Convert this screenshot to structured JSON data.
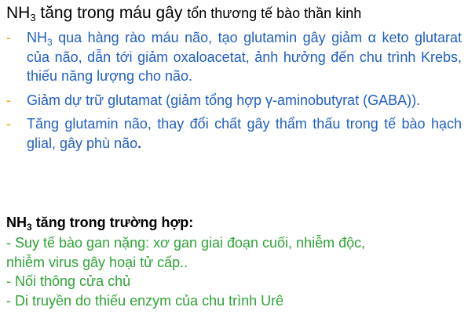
{
  "title": {
    "nh": "NH",
    "sub": "3",
    "main": " tăng trong máu gây ",
    "rest": "tổn thương tế bào thần kinh"
  },
  "effects": [
    {
      "dash": "-",
      "nh": "NH",
      "sub": "3",
      "text": " qua hàng rào máu não, tạo glutamin gây giảm α keto glutarat của não, dẫn tới giảm oxaloacetat, ảnh hưởng đến chu trình Krebs, thiếu năng lượng cho não."
    },
    {
      "dash": "-",
      "text": "Giảm dự trữ glutamat (giảm tổng hợp γ-aminobutyrat (GABA))."
    },
    {
      "dash": "-",
      "text": "Tăng glutamin não, thay đổi chất gây thẩm thấu trong tế bào hạch glial, gây phù não",
      "end": "."
    }
  ],
  "cases": {
    "heading_nh": "NH",
    "heading_sub": "3",
    "heading_rest": " tăng trong trường hợp:",
    "items": [
      "- Suy tế bào gan nặng: xơ gan giai đoạn cuối, nhiễm độc,",
      "nhiễm virus gây hoại tử cấp..",
      "- Nối thông cửa chủ",
      "- Di truyền do thiếu enzym của chu trình Urê"
    ]
  },
  "colors": {
    "blue_text": "#1f5fc4",
    "dash_accent": "#e8a21a",
    "green_text": "#2ea336",
    "heading_text": "#000000"
  }
}
